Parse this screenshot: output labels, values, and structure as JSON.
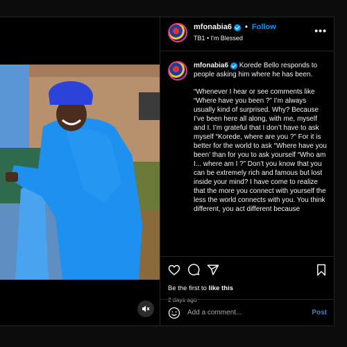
{
  "post": {
    "username": "mfonabia6",
    "follow_label": "Follow",
    "dot": "•",
    "subtitle": "TB1 • I'm Blessed",
    "more_label": "•••"
  },
  "caption": {
    "username": "mfonabia6",
    "headline": " Korede Bello responds to people asking him where he has been.",
    "body": "“Whenever I hear or see comments like “Where have you been ?” I’m always usually kind of surprised. Why? Because I’ve been here all along, with me, myself and I. I’m grateful that I don’t have to ask myself “Korede, where are you ?” For it is better for the world to ask “Where have you been’ than for you to ask yourself “Who am I... where am I ?” Don’t you know that you can be extremely rich and famous but lost inside your mind? I have come to realize that the more you connect with yourself the less the world connects with you. You think different, you act different because"
  },
  "engagement": {
    "likes_prefix": "Be the first to ",
    "likes_link": "like this",
    "timestamp": "2 days ago"
  },
  "comment_box": {
    "placeholder": "Add a comment...",
    "post_label": "Post"
  },
  "colors": {
    "accent": "#0095f6",
    "background": "#000000",
    "border": "#262626",
    "muted": "#a8a8a8"
  },
  "icons": [
    "heart-icon",
    "comment-icon",
    "share-icon",
    "bookmark-icon",
    "emoji-icon",
    "mute-icon",
    "more-options-icon",
    "verified-icon"
  ]
}
